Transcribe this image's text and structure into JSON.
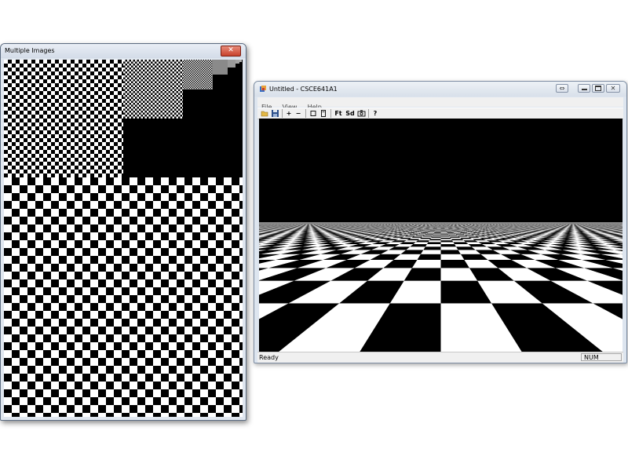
{
  "window_multiple_images": {
    "title": "Multiple Images",
    "close_glyph": "✕"
  },
  "window_main": {
    "title": "Untitled - CSCE641A1",
    "menu": [
      "File",
      "View",
      "Help"
    ],
    "toolbar": {
      "open_icon": "open-folder-icon",
      "save_icon": "save-icon",
      "zoom_in": "+",
      "zoom_out": "−",
      "fit": "Ft",
      "shade": "Sd",
      "help": "?"
    },
    "status": {
      "ready": "Ready",
      "num": "NUM"
    }
  },
  "colors": {
    "checker_dark": "#000000",
    "checker_light": "#ffffff",
    "close_button": "#c8422c"
  }
}
